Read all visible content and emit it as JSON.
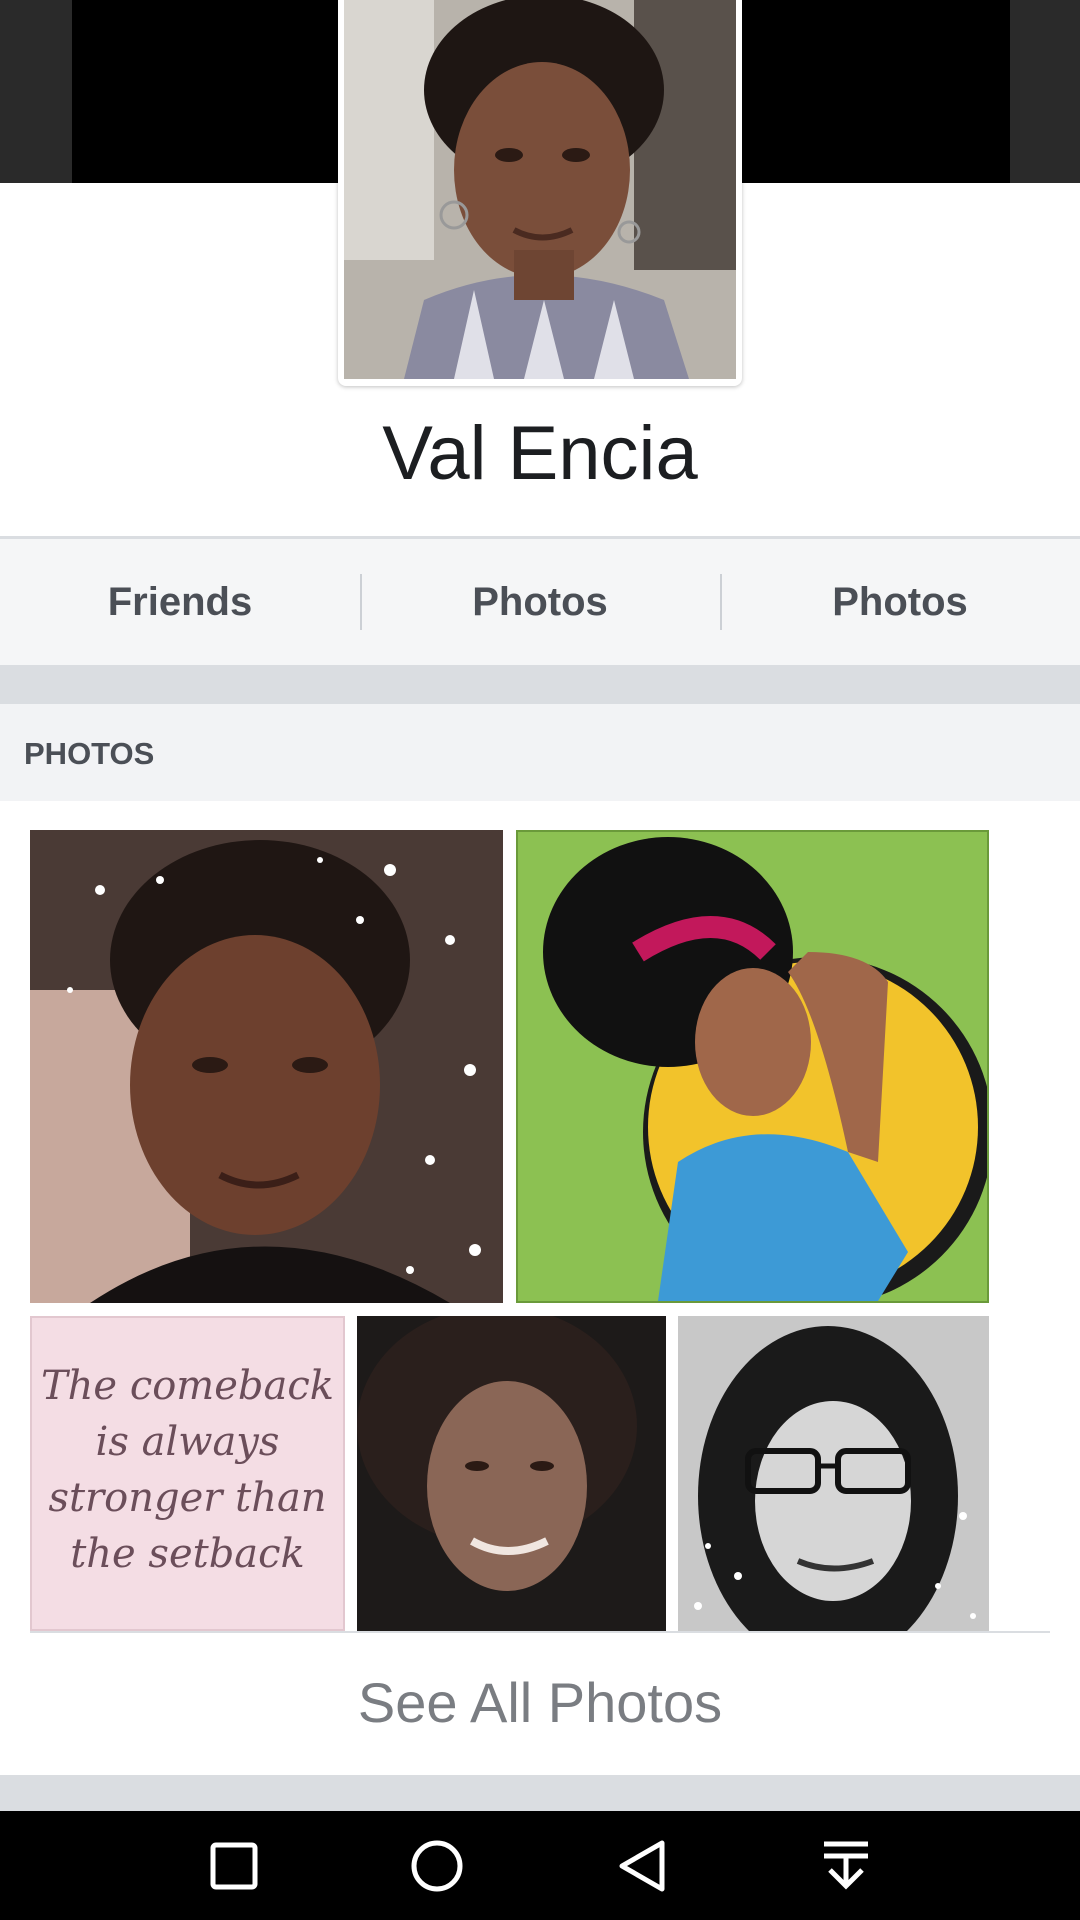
{
  "profile": {
    "name": "Val Encia"
  },
  "tabs": [
    {
      "label": "Friends"
    },
    {
      "label": "Photos"
    },
    {
      "label": "Photos"
    }
  ],
  "photos_section": {
    "header": "PHOTOS",
    "quote_text": "The comeback\nis always\nstronger than\nthe setback",
    "see_all_label": "See All Photos"
  },
  "nav_bar": {
    "icons": [
      "square-icon",
      "circle-icon",
      "back-triangle-icon",
      "download-arrow-icon"
    ]
  },
  "colors": {
    "cover": "#000000",
    "tab_bar": "#f5f6f7",
    "separator": "#dadde1",
    "text_dark": "#1c1e21",
    "text_muted": "#7a7d82"
  }
}
